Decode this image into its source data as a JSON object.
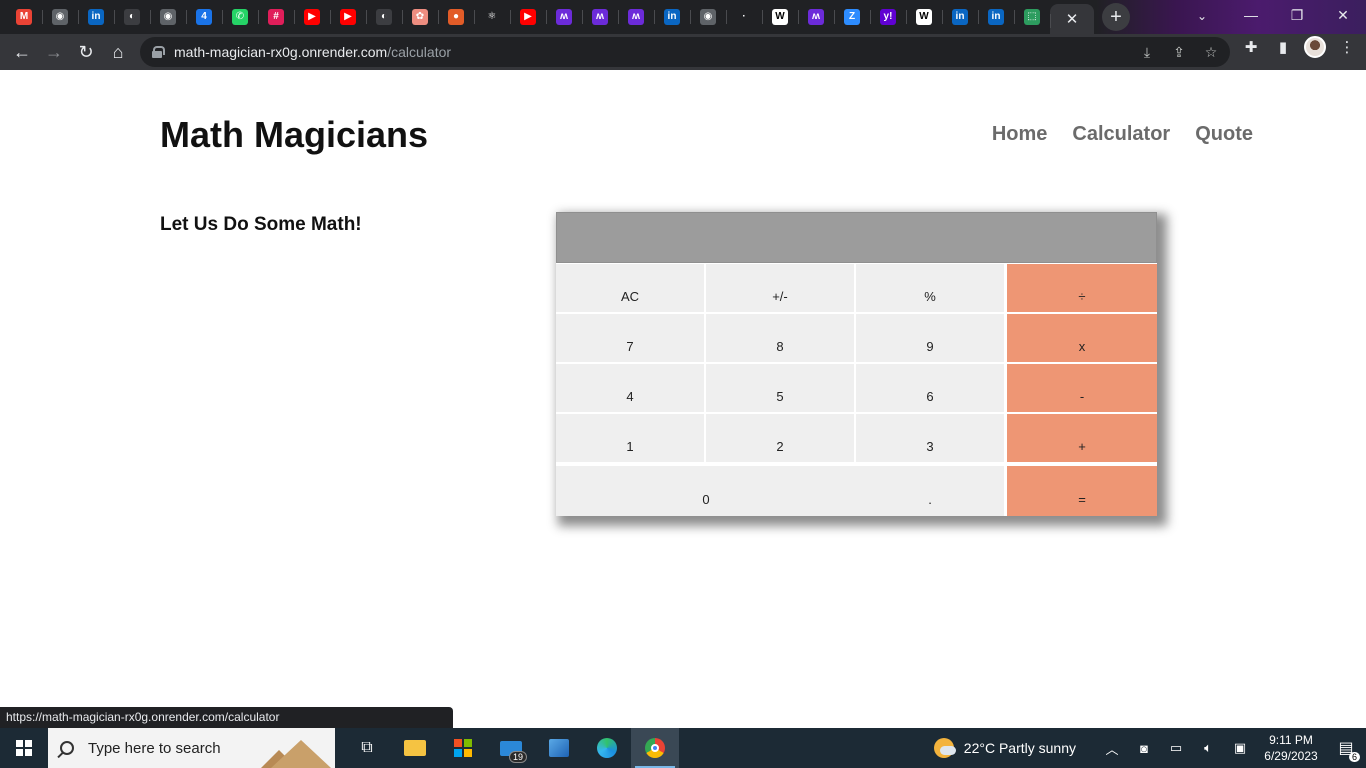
{
  "browser": {
    "tabs": [
      {
        "icon": "gmail-icon",
        "glyph": "M",
        "color": "#ea4335"
      },
      {
        "icon": "globe-icon",
        "glyph": "◉",
        "color": "#5f6368"
      },
      {
        "icon": "linkedin-icon",
        "glyph": "in",
        "color": "#0a66c2"
      },
      {
        "icon": "github-icon",
        "glyph": "◐",
        "color": "#3c3d41"
      },
      {
        "icon": "globe-icon",
        "glyph": "◉",
        "color": "#5f6368"
      },
      {
        "icon": "badge-4-icon",
        "glyph": "4",
        "color": "#1a73e8"
      },
      {
        "icon": "whatsapp-icon",
        "glyph": "✆",
        "color": "#25d366"
      },
      {
        "icon": "slack-icon",
        "glyph": "#",
        "color": "#e01e5a"
      },
      {
        "icon": "youtube-icon",
        "glyph": "▶",
        "color": "#ff0000"
      },
      {
        "icon": "youtube-icon",
        "glyph": "▶",
        "color": "#ff0000"
      },
      {
        "icon": "github-icon",
        "glyph": "◐",
        "color": "#3c3d41"
      },
      {
        "icon": "openai-icon",
        "glyph": "✿",
        "color": "#ee8d80"
      },
      {
        "icon": "helmet-icon",
        "glyph": "●",
        "color": "#e25c28"
      },
      {
        "icon": "react-icon",
        "glyph": "⚛",
        "color": "#202124"
      },
      {
        "icon": "youtube-icon",
        "glyph": "▶",
        "color": "#ff0000"
      },
      {
        "icon": "microverse-icon",
        "glyph": "ʍ",
        "color": "#6c2bd9"
      },
      {
        "icon": "microverse-icon",
        "glyph": "ʍ",
        "color": "#6c2bd9"
      },
      {
        "icon": "microverse-icon",
        "glyph": "ʍ",
        "color": "#6c2bd9"
      },
      {
        "icon": "linkedin-icon",
        "glyph": "in",
        "color": "#0a66c2"
      },
      {
        "icon": "globe-icon",
        "glyph": "◉",
        "color": "#5f6368"
      },
      {
        "icon": "dot-icon",
        "glyph": "·",
        "color": "#202124"
      },
      {
        "icon": "wordle-icon",
        "glyph": "W",
        "color": "#ffffff"
      },
      {
        "icon": "microverse-icon",
        "glyph": "ʍ",
        "color": "#6c2bd9"
      },
      {
        "icon": "zoom-icon",
        "glyph": "Z",
        "color": "#2d8cff"
      },
      {
        "icon": "yahoo-icon",
        "glyph": "y!",
        "color": "#6001d2"
      },
      {
        "icon": "wordle-icon",
        "glyph": "W",
        "color": "#ffffff"
      },
      {
        "icon": "linkedin-icon",
        "glyph": "in",
        "color": "#0a66c2"
      },
      {
        "icon": "linkedin-icon",
        "glyph": "in",
        "color": "#0a66c2"
      },
      {
        "icon": "render-icon",
        "glyph": "⬚",
        "color": "#2d9c5f"
      }
    ],
    "url_host": "math-magician-rx0g.onrender.com",
    "url_path": "/calculator",
    "status_url": "https://math-magician-rx0g.onrender.com/calculator"
  },
  "site": {
    "title": "Math Magicians",
    "nav": [
      "Home",
      "Calculator",
      "Quote"
    ],
    "intro": "Let Us Do Some Math!"
  },
  "calculator": {
    "display": "",
    "rows": [
      [
        "AC",
        "+/-",
        "%",
        "÷"
      ],
      [
        "7",
        "8",
        "9",
        "x"
      ],
      [
        "4",
        "5",
        "6",
        "-"
      ],
      [
        "1",
        "2",
        "3",
        "+"
      ],
      [
        "0",
        ".",
        "="
      ]
    ],
    "colors": {
      "operator": "#ee9674",
      "digit": "#efefef",
      "display": "#9c9c9c"
    }
  },
  "taskbar": {
    "search_placeholder": "Type here to search",
    "mail_badge": "19",
    "weather": "22°C  Partly sunny",
    "time": "9:11 PM",
    "date": "6/29/2023",
    "notifications": "6"
  }
}
